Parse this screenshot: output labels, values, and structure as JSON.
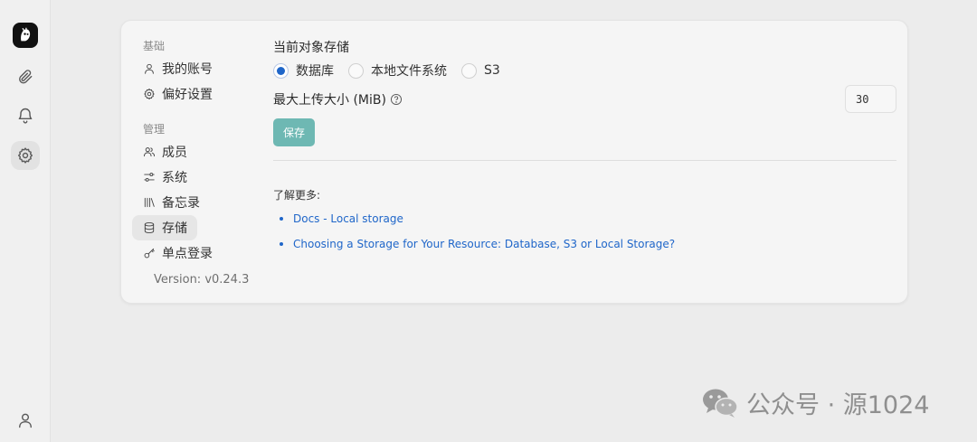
{
  "sidebar": {
    "icons": [
      "app-logo",
      "paperclip-icon",
      "bell-icon",
      "gear-icon",
      "user-icon"
    ]
  },
  "settings_nav": {
    "basic_section": "基础",
    "manage_section": "管理",
    "items": [
      {
        "label": "我的账号",
        "icon": "user-icon"
      },
      {
        "label": "偏好设置",
        "icon": "gear-icon"
      },
      {
        "label": "成员",
        "icon": "users-icon"
      },
      {
        "label": "系统",
        "icon": "sliders-icon"
      },
      {
        "label": "备忘录",
        "icon": "library-icon"
      },
      {
        "label": "存储",
        "icon": "database-icon",
        "active": true
      },
      {
        "label": "单点登录",
        "icon": "key-icon"
      }
    ],
    "version": "Version: v0.24.3"
  },
  "storage": {
    "title": "当前对象存储",
    "options": [
      {
        "label": "数据库",
        "selected": true
      },
      {
        "label": "本地文件系统",
        "selected": false
      },
      {
        "label": "S3",
        "selected": false
      }
    ],
    "max_upload_label": "最大上传大小 (MiB)",
    "max_upload_value": "30",
    "save_label": "保存",
    "learn_more": "了解更多:",
    "links": [
      "Docs - Local storage",
      "Choosing a Storage for Your Resource: Database, S3 or Local Storage?"
    ]
  },
  "watermark": {
    "text": "公众号 · 源1024"
  },
  "colors": {
    "accent": "#1f66c9",
    "save_button": "#6eb8b3",
    "background": "#ececec",
    "card": "#f5f5f5"
  }
}
